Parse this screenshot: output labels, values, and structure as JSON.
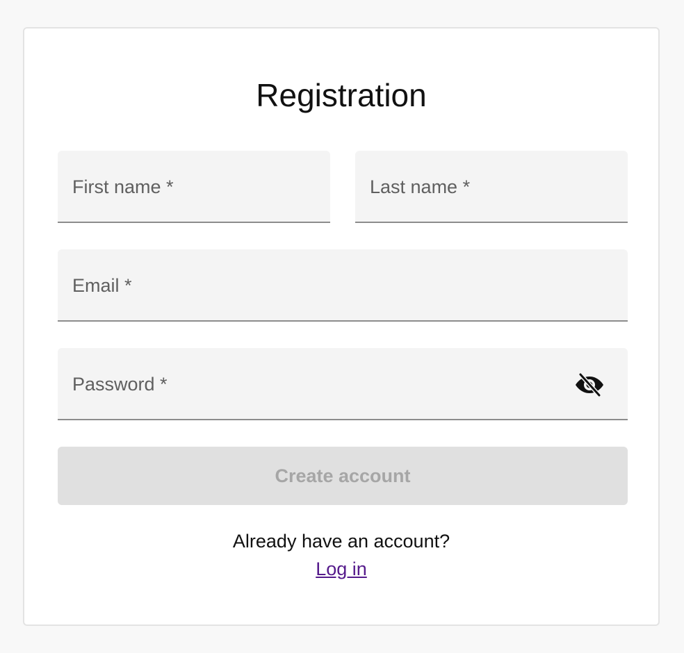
{
  "form": {
    "title": "Registration",
    "first_name": {
      "label": "First name *",
      "value": ""
    },
    "last_name": {
      "label": "Last name *",
      "value": ""
    },
    "email": {
      "label": "Email *",
      "value": ""
    },
    "password": {
      "label": "Password *",
      "value": "",
      "visibility_icon": "eye-off-icon"
    },
    "submit_label": "Create account",
    "submit_disabled": true
  },
  "footer": {
    "prompt": "Already have an account?",
    "login_link": "Log in"
  },
  "colors": {
    "link": "#551a8b",
    "button_disabled_bg": "#e0e0e0",
    "button_disabled_text": "#a6a6a6",
    "field_bg": "#f4f4f4"
  }
}
